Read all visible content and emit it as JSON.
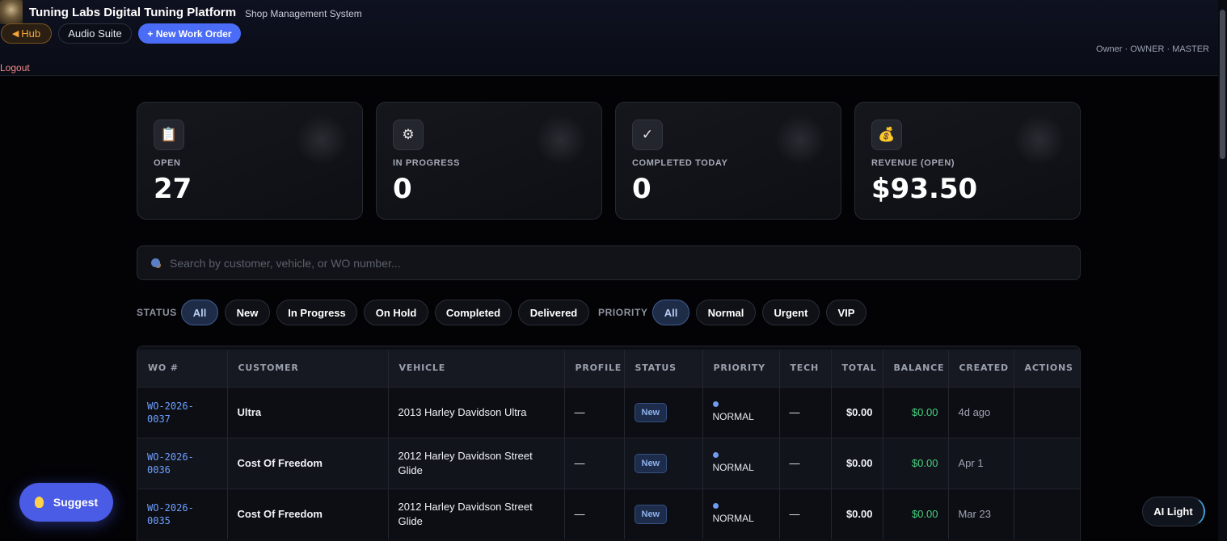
{
  "header": {
    "title": "Tuning Labs Digital Tuning Platform",
    "subtitle": "Shop Management System",
    "hub_label": "Hub",
    "audio_label": "Audio Suite",
    "new_wo_label": "+ New Work Order",
    "user_info": "Owner · OWNER · MASTER",
    "logout_label": "Logout"
  },
  "stats": [
    {
      "icon": "clipboard-icon",
      "glyph": "📋",
      "label": "OPEN",
      "value": "27"
    },
    {
      "icon": "gear-icon",
      "glyph": "⚙",
      "label": "IN PROGRESS",
      "value": "0"
    },
    {
      "icon": "checkmark-icon",
      "glyph": "✓",
      "label": "COMPLETED TODAY",
      "value": "0"
    },
    {
      "icon": "money-bag-icon",
      "glyph": "💰",
      "label": "REVENUE (OPEN)",
      "value": "$93.50"
    }
  ],
  "search": {
    "placeholder": "Search by customer, vehicle, or WO number..."
  },
  "filters": {
    "status_label": "STATUS",
    "status_options": [
      "All",
      "New",
      "In Progress",
      "On Hold",
      "Completed",
      "Delivered"
    ],
    "status_selected": "All",
    "priority_label": "PRIORITY",
    "priority_options": [
      "All",
      "Normal",
      "Urgent",
      "VIP"
    ],
    "priority_selected": "All"
  },
  "table": {
    "columns": [
      "WO #",
      "CUSTOMER",
      "VEHICLE",
      "PROFILE",
      "STATUS",
      "PRIORITY",
      "TECH",
      "TOTAL",
      "BALANCE",
      "CREATED",
      "ACTIONS"
    ],
    "rows": [
      {
        "wo_line1": "WO-2026-",
        "wo_line2": "0037",
        "customer": "Ultra",
        "vehicle": "2013 Harley Davidson Ultra",
        "profile": "—",
        "status": "New",
        "priority": "NORMAL",
        "tech": "—",
        "total": "$0.00",
        "balance": "$0.00",
        "created": "4d ago",
        "actions": ""
      },
      {
        "wo_line1": "WO-2026-",
        "wo_line2": "0036",
        "customer": "Cost Of Freedom",
        "vehicle": "2012 Harley Davidson Street Glide",
        "profile": "—",
        "status": "New",
        "priority": "NORMAL",
        "tech": "—",
        "total": "$0.00",
        "balance": "$0.00",
        "created": "Apr 1",
        "actions": ""
      },
      {
        "wo_line1": "WO-2026-",
        "wo_line2": "0035",
        "customer": "Cost Of Freedom",
        "vehicle": "2012 Harley Davidson Street Glide",
        "profile": "—",
        "status": "New",
        "priority": "NORMAL",
        "tech": "—",
        "total": "$0.00",
        "balance": "$0.00",
        "created": "Mar 23",
        "actions": ""
      }
    ]
  },
  "floating": {
    "suggest_label": "Suggest",
    "ai_light_label": "AI Light"
  },
  "colors": {
    "accent": "#4a6cf7",
    "hub": "#f5a63a",
    "link": "#6ea0ff",
    "balance": "#47d27e",
    "logout": "#f28b8b"
  }
}
